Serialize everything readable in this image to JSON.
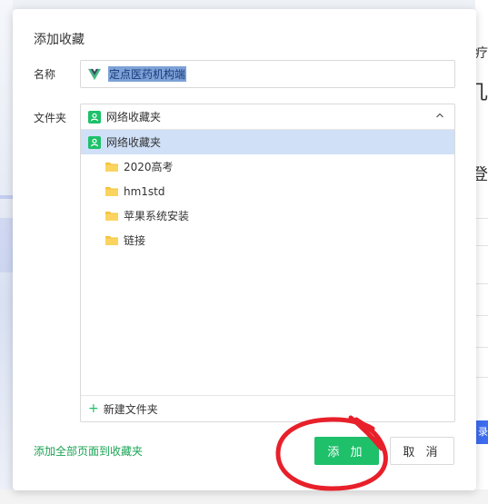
{
  "dialog": {
    "title": "添加收藏",
    "name_label": "名称",
    "name_value": "定点医药机构端",
    "folder_label": "文件夹",
    "selected_folder": "网络收藏夹",
    "tree": {
      "root": "网络收藏夹",
      "children": [
        "2020高考",
        "hm1std",
        "苹果系统安装",
        "链接"
      ]
    },
    "new_folder": "新建文件夹",
    "add_all": "添加全部页面到收藏夹",
    "add_button": "添 加",
    "cancel_button": "取 消"
  },
  "background": {
    "frag1": "疗",
    "frag2": "几",
    "frag3": "登",
    "frag4": "录"
  },
  "colors": {
    "accent_green": "#1ec06a",
    "link_green": "#1aa454",
    "selection_blue": "#cfe0f7",
    "annotation_red": "#e8202a"
  },
  "icons": {
    "site_icon": "vue-logo-icon",
    "folder_root_icon": "green-user-icon",
    "folder_icon": "folder-icon",
    "dropdown_icon": "chevron-up-icon",
    "new_folder_icon": "plus-icon"
  }
}
